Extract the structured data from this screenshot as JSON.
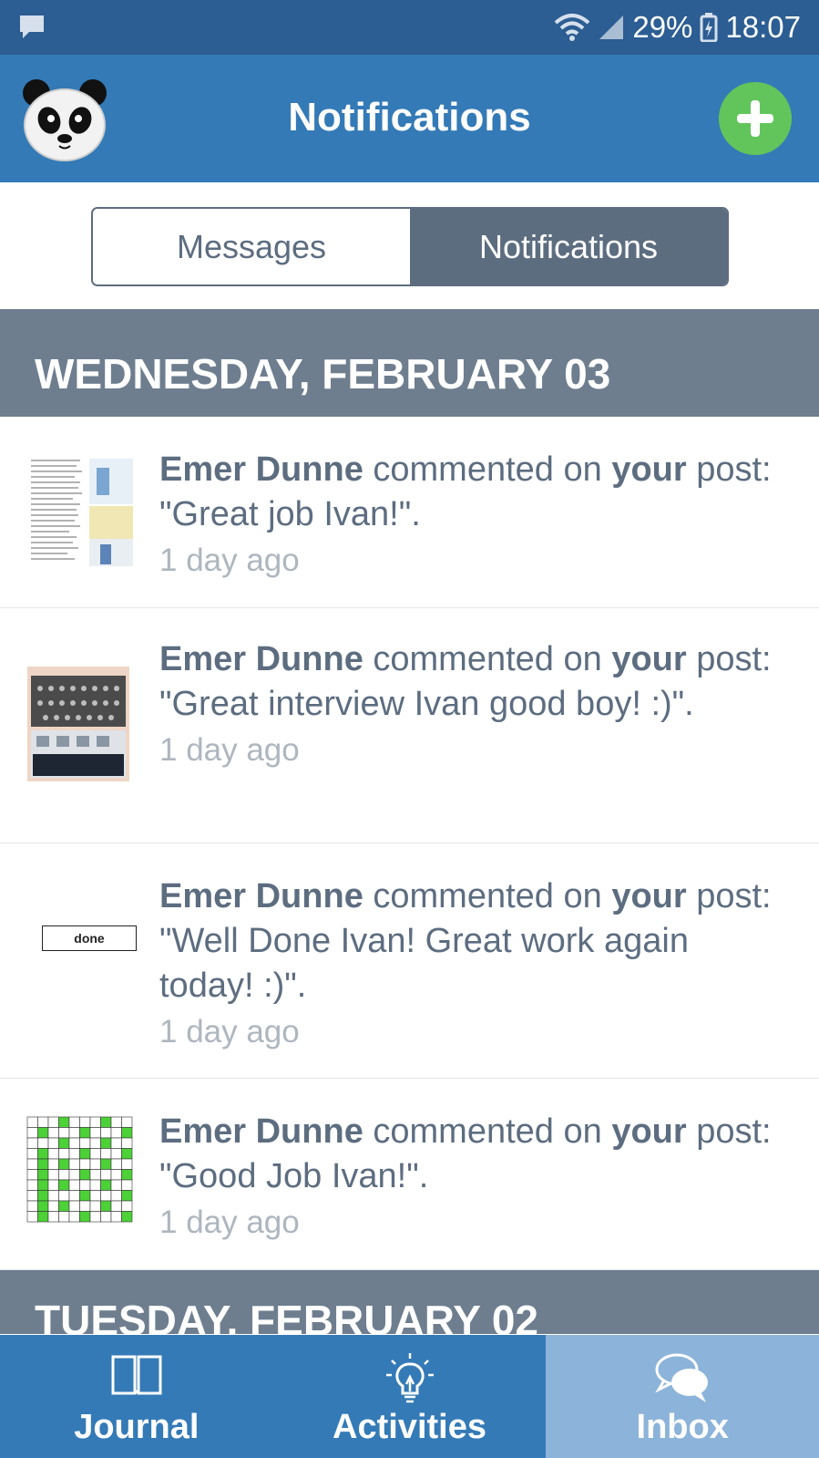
{
  "status_bar": {
    "battery": "29%",
    "time": "18:07"
  },
  "header": {
    "title": "Notifications"
  },
  "segments": {
    "messages": "Messages",
    "notifications": "Notifications"
  },
  "days": [
    {
      "label": "WEDNESDAY, FEBRUARY 03",
      "items": [
        {
          "author": "Emer Dunne",
          "before": " commented on ",
          "bold": "your",
          "after": " post: \"Great job Ivan!\".",
          "time": "1 day ago"
        },
        {
          "author": "Emer Dunne",
          "before": " commented on ",
          "bold": "your",
          "after": " post: \"Great interview Ivan good boy! :)\".",
          "time": "1 day ago"
        },
        {
          "author": "Emer Dunne",
          "before": " commented on ",
          "bold": "your",
          "after": " post: \"Well Done Ivan! Great work again today! :)\".",
          "time": "1 day ago",
          "thumb_text": "done"
        },
        {
          "author": "Emer Dunne",
          "before": " commented on ",
          "bold": "your",
          "after": " post: \"Good Job Ivan!\".",
          "time": "1 day ago"
        }
      ]
    },
    {
      "label": "TUESDAY, FEBRUARY 02"
    }
  ],
  "tabs": {
    "journal": "Journal",
    "activities": "Activities",
    "inbox": "Inbox"
  },
  "colors": {
    "header": "#347ab6",
    "status_bar": "#2c5d93",
    "accent_green": "#62c55b",
    "segment": "#5d6d80",
    "day_header": "#6e7e8f",
    "active_tab": "#8cb3d9"
  }
}
